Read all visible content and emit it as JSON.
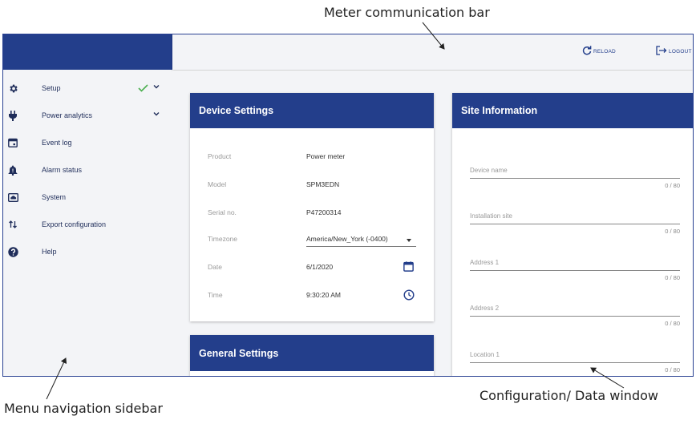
{
  "annotations": {
    "top": "Meter communication bar",
    "left": "Menu navigation sidebar",
    "right": "Configuration/ Data window"
  },
  "colors": {
    "primary": "#233e8b",
    "check": "#4caf50",
    "background": "#f3f4f7"
  },
  "topbar": {
    "reload": {
      "label": "RELOAD",
      "icon": "reload-icon"
    },
    "logout": {
      "label": "LOGOUT",
      "icon": "logout-icon"
    }
  },
  "sidebar": {
    "items": [
      {
        "label": "Setup",
        "icon": "gear-icon",
        "checked": true,
        "expandable": true
      },
      {
        "label": "Power analytics",
        "icon": "plug-icon",
        "expandable": true
      },
      {
        "label": "Event log",
        "icon": "calendar-icon"
      },
      {
        "label": "Alarm status",
        "icon": "bell-icon"
      },
      {
        "label": "System",
        "icon": "system-icon"
      },
      {
        "label": "Export configuration",
        "icon": "transfer-arrows-icon"
      },
      {
        "label": "Help",
        "icon": "help-icon"
      }
    ]
  },
  "device_settings": {
    "title": "Device Settings",
    "rows": [
      {
        "key": "Product",
        "value": "Power meter"
      },
      {
        "key": "Model",
        "value": "SPM3EDN"
      },
      {
        "key": "Serial no.",
        "value": "P47200314"
      },
      {
        "key": "Timezone",
        "value": "America/New_York (-0400)"
      },
      {
        "key": "Date",
        "value": "6/1/2020"
      },
      {
        "key": "Time",
        "value": "9:30:20 AM"
      }
    ]
  },
  "general_settings": {
    "title": "General Settings"
  },
  "site_information": {
    "title": "Site Information",
    "fields": [
      {
        "label": "Device name",
        "count": "0 / 80"
      },
      {
        "label": "Installation site",
        "count": "0 / 80"
      },
      {
        "label": "Address 1",
        "count": "0 / 80"
      },
      {
        "label": "Address 2",
        "count": "0 / 80"
      },
      {
        "label": "Location 1",
        "count": "0 / 80"
      }
    ]
  }
}
